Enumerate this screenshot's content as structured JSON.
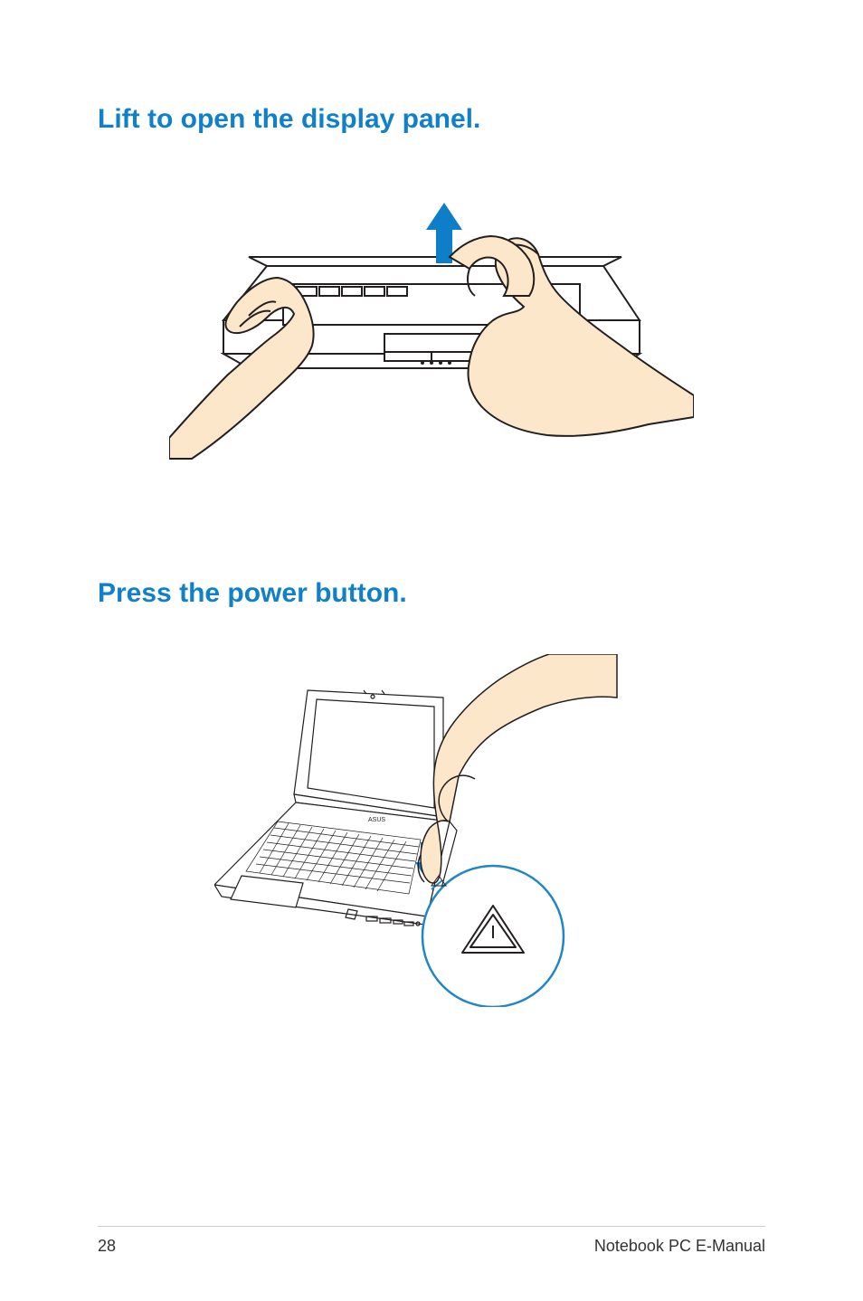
{
  "headings": {
    "step1": "Lift to open the display panel.",
    "step2": "Press the power button."
  },
  "footer": {
    "page_number": "28",
    "manual_title": "Notebook PC E-Manual"
  },
  "colors": {
    "heading_blue": "#1080cb",
    "arrow_blue": "#0f7ec9",
    "skin_tone": "#fce7cb",
    "line_black": "#231f20",
    "circle_blue": "#2186c6"
  }
}
